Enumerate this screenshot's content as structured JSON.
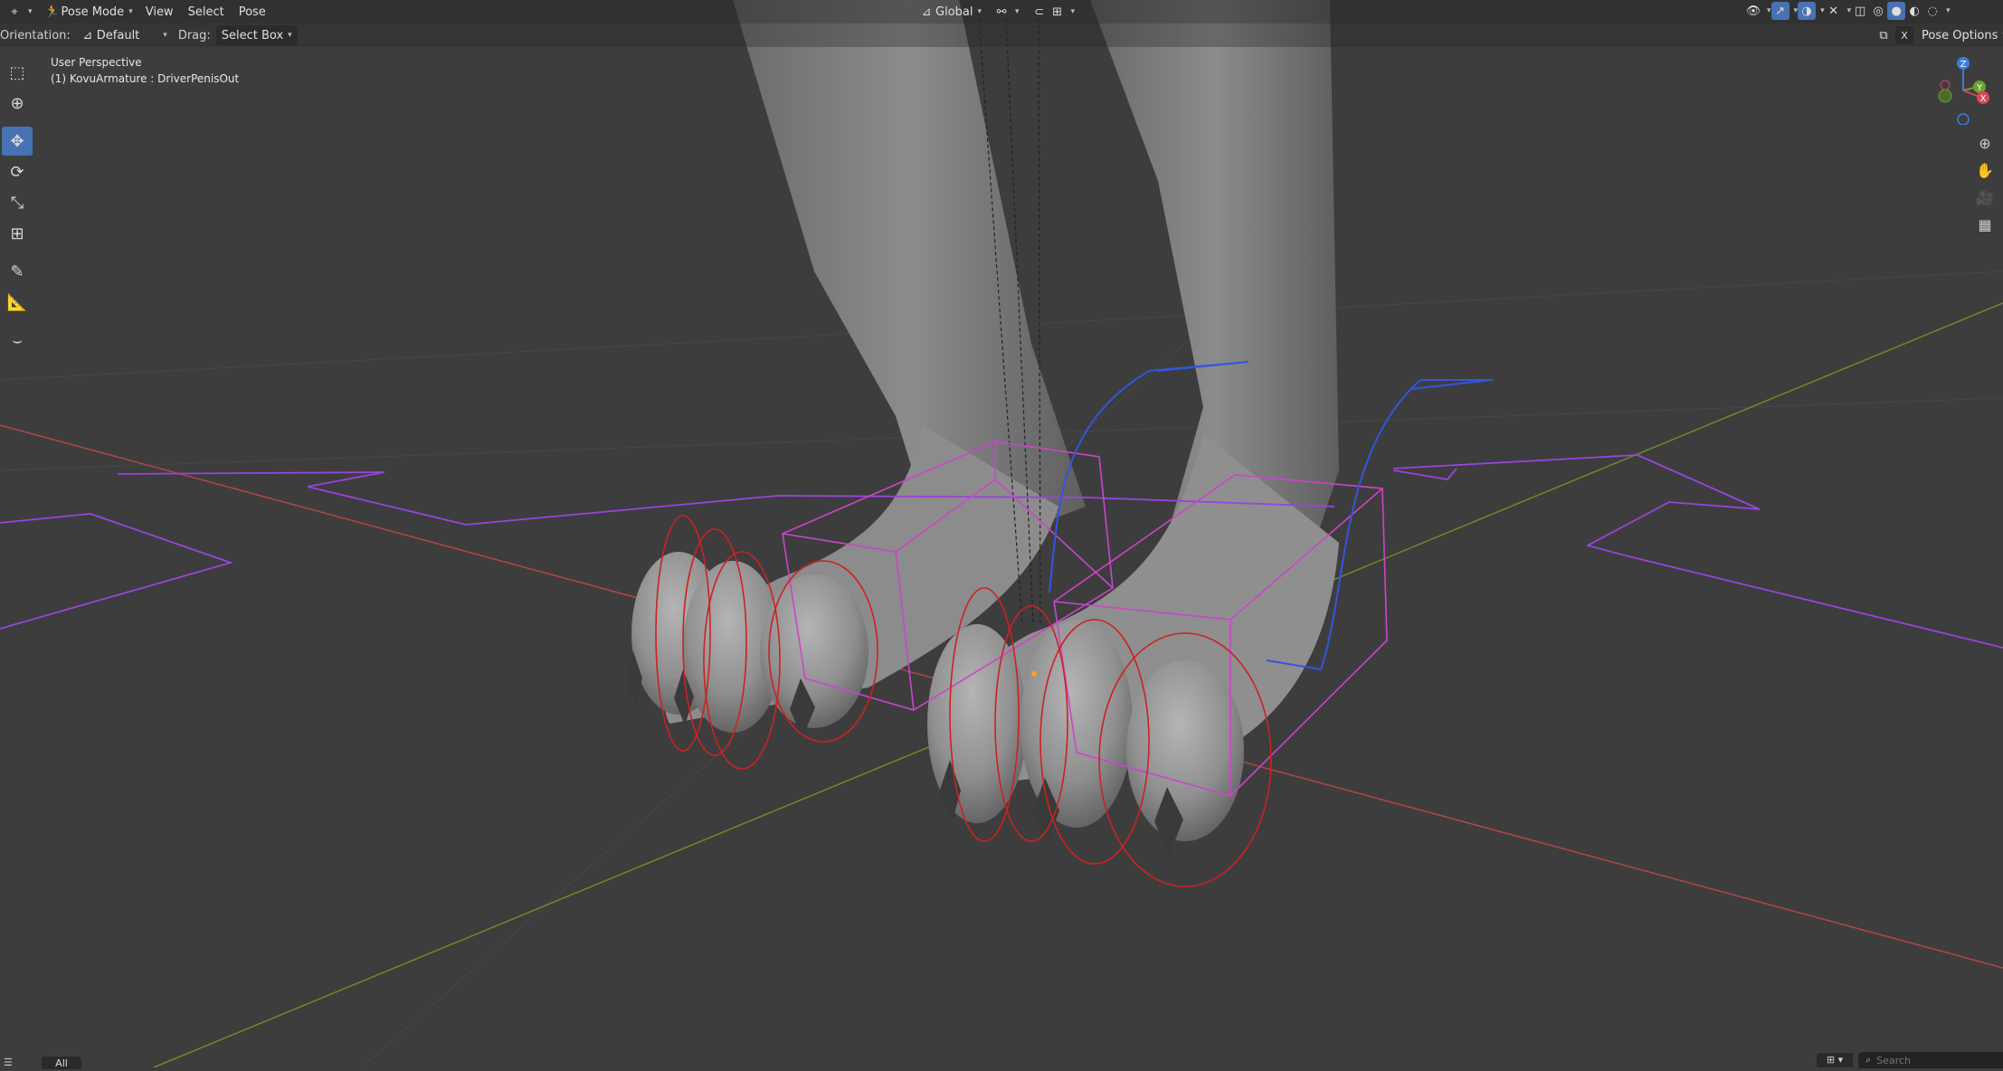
{
  "header": {
    "editor_type_icon": "axis-icon",
    "mode": "Pose Mode",
    "menus": [
      "View",
      "Select",
      "Pose"
    ],
    "transform_orientation": "Global"
  },
  "tool_settings": {
    "orientation_label": "Orientation:",
    "orientation_value": "Default",
    "drag_label": "Drag:",
    "drag_value": "Select Box",
    "pose_options": "Pose Options",
    "x_mirror": "X"
  },
  "viewport_info": {
    "view_name": "User Perspective",
    "active_object": "(1) KovuArmature : DriverPenisOut"
  },
  "tools": [
    {
      "name": "select-box-icon",
      "glyph": "⬚",
      "active": false
    },
    {
      "name": "cursor-icon",
      "glyph": "⊕",
      "active": false
    },
    {
      "name": "move-icon",
      "glyph": "✥",
      "active": true
    },
    {
      "name": "rotate-icon",
      "glyph": "⟳",
      "active": false
    },
    {
      "name": "scale-icon",
      "glyph": "⤡",
      "active": false
    },
    {
      "name": "transform-icon",
      "glyph": "⊞",
      "active": false
    },
    {
      "name": "annotate-icon",
      "glyph": "✎",
      "active": false
    },
    {
      "name": "measure-icon",
      "glyph": "📐",
      "active": false
    },
    {
      "name": "relax-pose-icon",
      "glyph": "⌣",
      "active": false
    }
  ],
  "gizmo": {
    "z": "Z",
    "y": "Y",
    "x": "X"
  },
  "status": {
    "tab_all": "All",
    "search_placeholder": "Search"
  },
  "colors": {
    "background": "#3d3d3d",
    "accent": "#4772b3",
    "x_axis": "#c84a4a",
    "y_axis": "#6b8c2a",
    "bone_red": "#cc2222",
    "bone_magenta": "#cc44cc",
    "bone_blue": "#3355dd",
    "bone_purple": "#9944dd"
  }
}
